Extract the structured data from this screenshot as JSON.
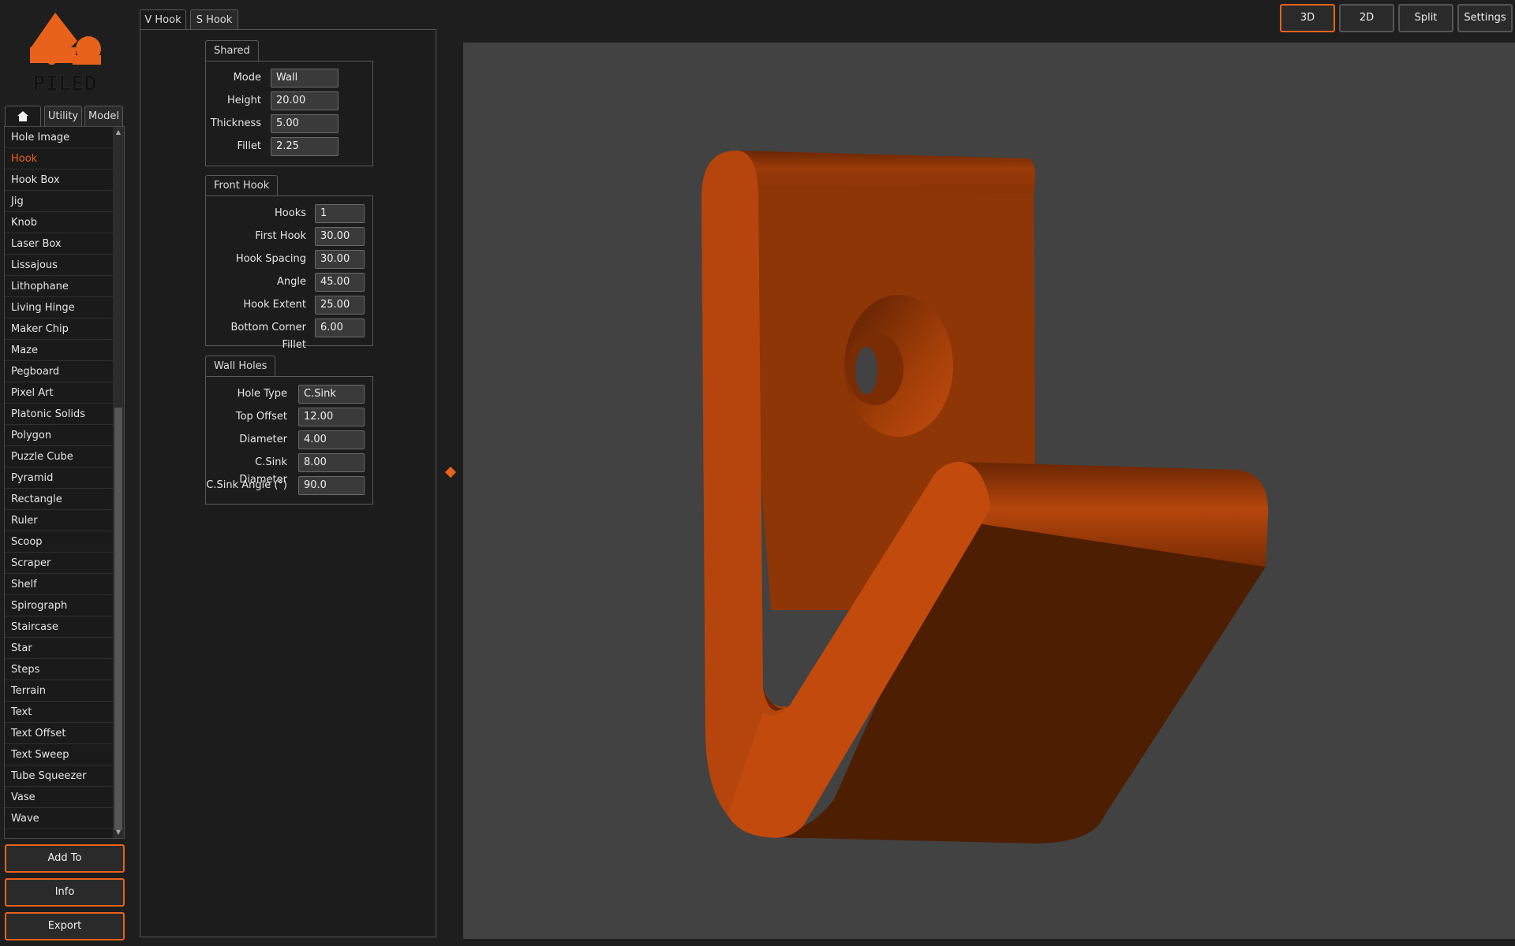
{
  "logo": {
    "text": "PILED"
  },
  "colors": {
    "accent": "#e8621c",
    "model": "#c24a0c",
    "viewport": "#424242"
  },
  "left_tabs": {
    "home_icon": "home-icon",
    "utility": "Utility",
    "model": "Model"
  },
  "model_list": {
    "items": [
      "Hole Image",
      "Hook",
      "Hook Box",
      "Jig",
      "Knob",
      "Laser Box",
      "Lissajous",
      "Lithophane",
      "Living Hinge",
      "Maker Chip",
      "Maze",
      "Pegboard",
      "Pixel Art",
      "Platonic Solids",
      "Polygon",
      "Puzzle Cube",
      "Pyramid",
      "Rectangle",
      "Ruler",
      "Scoop",
      "Scraper",
      "Shelf",
      "Spirograph",
      "Staircase",
      "Star",
      "Steps",
      "Terrain",
      "Text",
      "Text Offset",
      "Text Sweep",
      "Tube Squeezer",
      "Vase",
      "Wave"
    ],
    "selected": "Hook"
  },
  "buttons": {
    "add_to": "Add To",
    "info": "Info",
    "export": "Export"
  },
  "top_tabs": {
    "v_hook": "V Hook",
    "s_hook": "S Hook"
  },
  "view_buttons": {
    "three_d": "3D",
    "two_d": "2D",
    "split": "Split",
    "settings": "Settings",
    "active": "3D"
  },
  "shared": {
    "title": "Shared",
    "fields": [
      {
        "label": "Mode",
        "value": "Wall"
      },
      {
        "label": "Height",
        "value": "20.00"
      },
      {
        "label": "Thickness",
        "value": "5.00"
      },
      {
        "label": "Fillet",
        "value": "2.25"
      }
    ]
  },
  "front_hook": {
    "title": "Front Hook",
    "fields": [
      {
        "label": "Hooks",
        "value": "1"
      },
      {
        "label": "First Hook",
        "value": "30.00"
      },
      {
        "label": "Hook Spacing",
        "value": "30.00"
      },
      {
        "label": "Angle",
        "value": "45.00"
      },
      {
        "label": "Hook Extent",
        "value": "25.00"
      },
      {
        "label": "Bottom Corner Fillet",
        "value": "6.00"
      }
    ]
  },
  "wall_holes": {
    "title": "Wall Holes",
    "fields": [
      {
        "label": "Hole Type",
        "value": "C.Sink"
      },
      {
        "label": "Top Offset",
        "value": "12.00"
      },
      {
        "label": "Diameter",
        "value": "4.00"
      },
      {
        "label": "C.Sink Diameter",
        "value": "8.00"
      },
      {
        "label": "C.Sink Angle (°)",
        "value": "90.0"
      }
    ]
  }
}
